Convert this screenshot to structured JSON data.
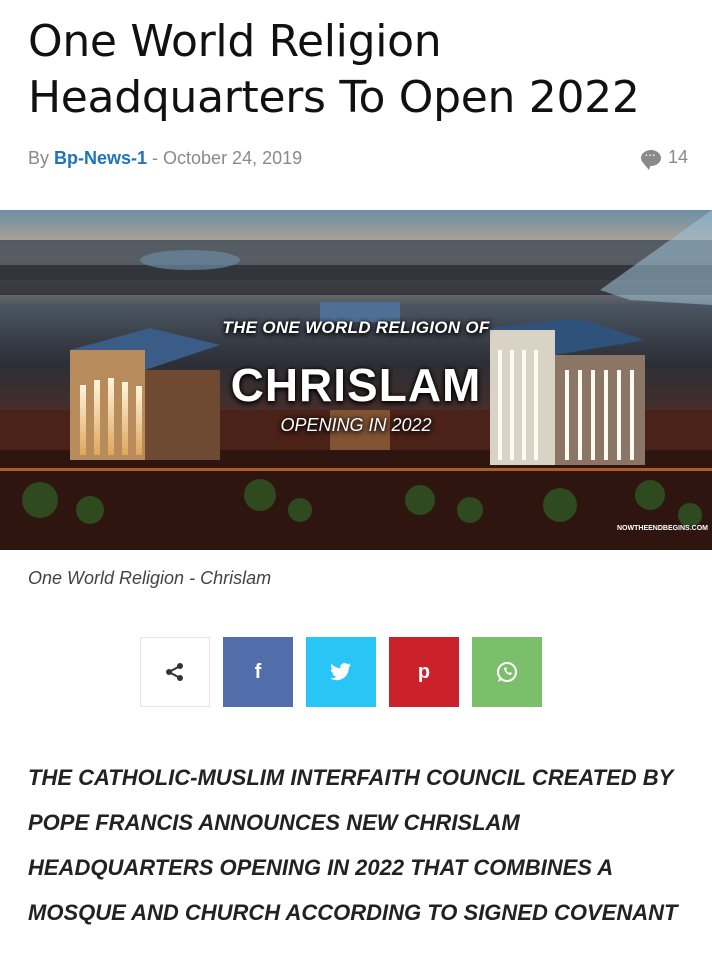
{
  "article": {
    "title": "One World Religion Headquarters To Open 2022",
    "by_label": "By",
    "author": "Bp-News-1",
    "separator": "-",
    "date": "October 24, 2019",
    "comment_count": "14"
  },
  "hero": {
    "line1": "THE ONE WORLD RELIGION OF",
    "line2": "CHRISLAM",
    "line3": "OPENING IN 2022",
    "watermark": "NOWTHEENDBEGINS.COM"
  },
  "caption": "One World Religion - Chrislam",
  "share": {
    "share_icon": "share-icon",
    "facebook_icon": "f",
    "twitter_icon": "twitter-bird-icon",
    "pinterest_icon": "p",
    "whatsapp_icon": "whatsapp-icon",
    "colors": {
      "facebook": "#516eab",
      "twitter": "#29c5f6",
      "pinterest": "#ca212a",
      "whatsapp": "#7bbf6a"
    }
  },
  "body": {
    "text": "THE CATHOLIC-MUSLIM INTERFAITH COUNCIL CREATED BY POPE FRANCIS ANNOUNCES NEW CHRISLAM HEADQUARTERS OPENING IN 2022 THAT COMBINES A MOSQUE AND CHURCH ACCORDING TO SIGNED COVENANT"
  }
}
